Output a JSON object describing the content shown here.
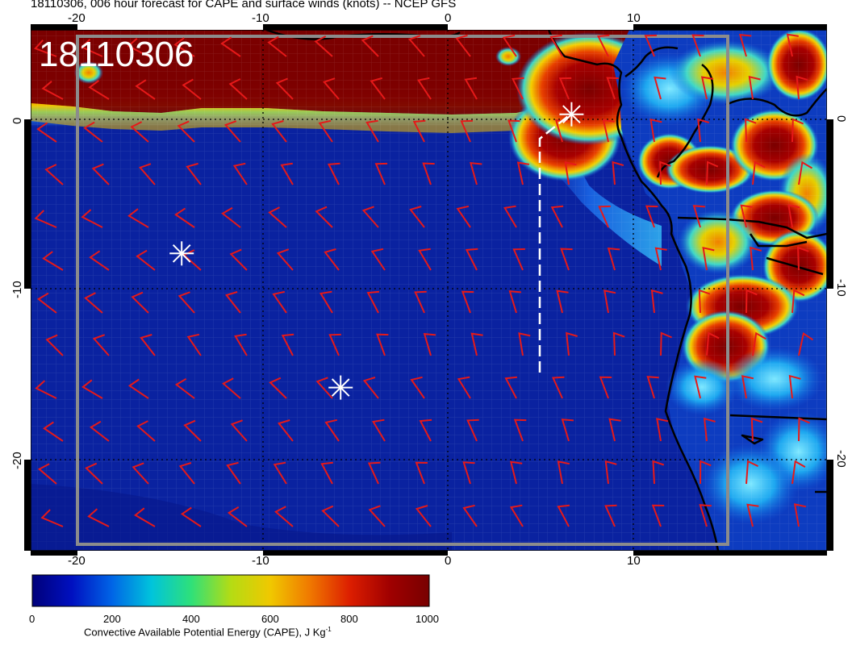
{
  "title": "18110306, 006 hour forecast for CAPE and surface winds (knots) -- NCEP GFS",
  "stamp": "18110306",
  "axes": {
    "lon_ticks": [
      "-20",
      "-10",
      "0",
      "10"
    ],
    "lat_ticks": [
      "0",
      "-10",
      "-20"
    ]
  },
  "colorbar": {
    "ticks": [
      "0",
      "200",
      "400",
      "600",
      "800",
      "1000"
    ],
    "label": "Convective Available Potential Energy (CAPE), J Kg",
    "label_sup": "-1",
    "colors": [
      "#00007a",
      "#0010c0",
      "#0064e6",
      "#00c4dc",
      "#2ee07a",
      "#b4dc14",
      "#f0c800",
      "#f07800",
      "#dc1e00",
      "#a00000",
      "#780000"
    ]
  },
  "colors": {
    "ocean": "#0a22a0",
    "ocean_deep": "#07178a",
    "cape_high": "#820000",
    "wind_barb": "#e61919",
    "coast": "#000000",
    "markers": "#ffffff",
    "box": "#8c8c8c"
  },
  "markers": [
    {
      "name": "star-west",
      "lon": -14.4,
      "lat": -7.9
    },
    {
      "name": "star-south",
      "lon": -5.8,
      "lat": -15.8
    },
    {
      "name": "star-north",
      "lon": 6.7,
      "lat": 0.3
    }
  ]
}
